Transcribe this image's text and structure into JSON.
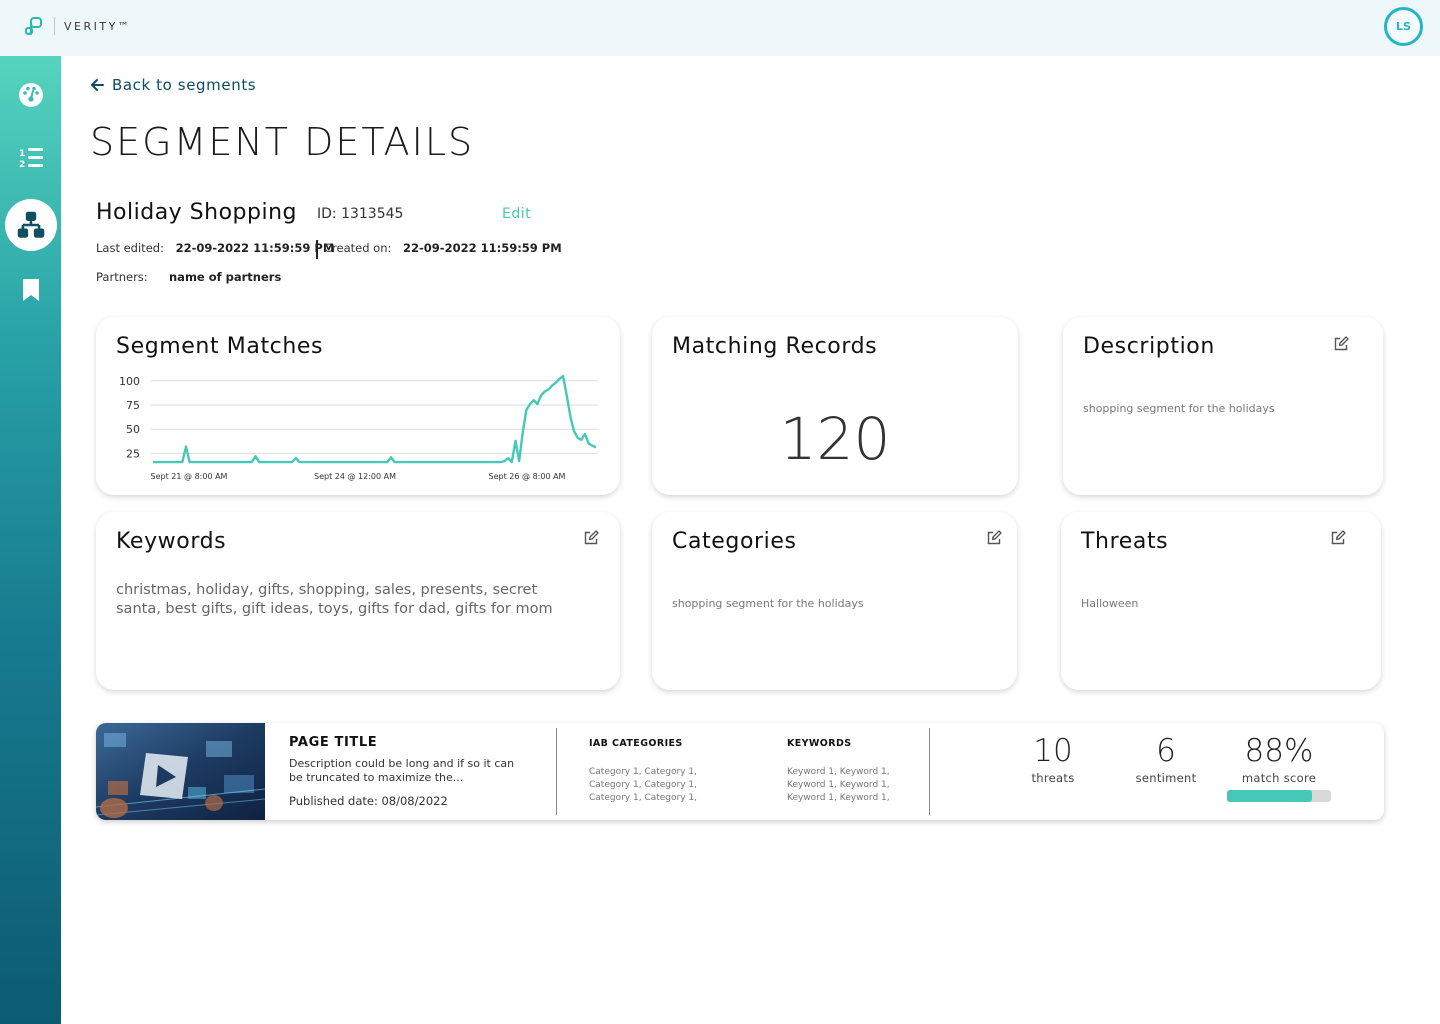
{
  "app": {
    "brand": "VERITY™",
    "user_initials": "LS"
  },
  "sidebar": {
    "items": [
      {
        "name": "dashboard",
        "icon": "gauge-icon"
      },
      {
        "name": "lists",
        "icon": "numbered-list-icon"
      },
      {
        "name": "segments",
        "icon": "hierarchy-icon",
        "active": true
      },
      {
        "name": "saved",
        "icon": "bookmark-icon"
      }
    ]
  },
  "nav": {
    "back_label": "Back to segments"
  },
  "page": {
    "title": "SEGMENT DETAILS"
  },
  "segment": {
    "name": "Holiday Shopping",
    "id_label": "ID: 1313545",
    "edit_label": "Edit",
    "last_edited_label": "Last edited:",
    "last_edited_value": "22-09-2022 11:59:59 PM",
    "created_label": "Created on:",
    "created_value": "22-09-2022 11:59:59 PM",
    "partners_label": "Partners:",
    "partners_value": "name of partners"
  },
  "cards": {
    "matches": {
      "title": "Segment Matches"
    },
    "records": {
      "title": "Matching Records",
      "value": "120"
    },
    "description": {
      "title": "Description",
      "text": "shopping segment for the holidays"
    },
    "keywords": {
      "title": "Keywords",
      "text": "christmas, holiday, gifts, shopping, sales, presents, secret santa, best gifts, gift ideas, toys, gifts for dad, gifts for mom"
    },
    "categories": {
      "title": "Categories",
      "text": "shopping segment for the holidays"
    },
    "threats": {
      "title": "Threats",
      "text": "Halloween"
    }
  },
  "chart_data": {
    "type": "line",
    "title": "Segment Matches",
    "xlabel": "",
    "ylabel": "",
    "x_tick_labels": [
      "Sept 21 @ 8:00 AM",
      "Sept 24 @ 12:00 AM",
      "Sept 26 @ 8:00 AM"
    ],
    "y_ticks": [
      25,
      50,
      75,
      100
    ],
    "ylim": [
      13,
      106
    ],
    "grid": true,
    "color": "#46c8b6",
    "series": [
      {
        "values": [
          16,
          16,
          16,
          16,
          16,
          16,
          16,
          16,
          16,
          32,
          16,
          16,
          16,
          16,
          16,
          16,
          16,
          16,
          16,
          16,
          16,
          16,
          16,
          16,
          16,
          16,
          16,
          16,
          22,
          16,
          16,
          16,
          16,
          16,
          16,
          16,
          16,
          16,
          16,
          20,
          16,
          16,
          16,
          16,
          16,
          16,
          16,
          16,
          16,
          16,
          16,
          16,
          16,
          16,
          16,
          16,
          16,
          16,
          16,
          16,
          16,
          16,
          16,
          16,
          16,
          21,
          16,
          16,
          16,
          16,
          16,
          16,
          16,
          16,
          16,
          16,
          16,
          16,
          16,
          16,
          16,
          16,
          16,
          16,
          16,
          16,
          16,
          16,
          16,
          16,
          16,
          16,
          16,
          16,
          16,
          16,
          17,
          20,
          16,
          38,
          17,
          47,
          70,
          76,
          80,
          76,
          85,
          89,
          91,
          95,
          98,
          102,
          105,
          85,
          63,
          48,
          41,
          39,
          45,
          35,
          33,
          31
        ]
      }
    ]
  },
  "result": {
    "page_title": "PAGE TITLE",
    "description": "Description could be long and if so it can be truncated to maximize the...",
    "published": "Published date: 08/08/2022",
    "iab_heading": "IAB CATEGORIES",
    "iab_items": [
      "Category 1, Category 1,",
      "Category 1, Category 1,",
      "Category 1, Category 1,"
    ],
    "keywords_heading": "KEYWORDS",
    "keyword_items": [
      "Keyword 1, Keyword 1,",
      "Keyword 1, Keyword 1,",
      "Keyword 1, Keyword 1,"
    ],
    "threats_value": "10",
    "threats_label": "threats",
    "sentiment_value": "6",
    "sentiment_label": "sentiment",
    "match_value": "88%",
    "match_label": "match score",
    "match_fraction": 0.82
  }
}
